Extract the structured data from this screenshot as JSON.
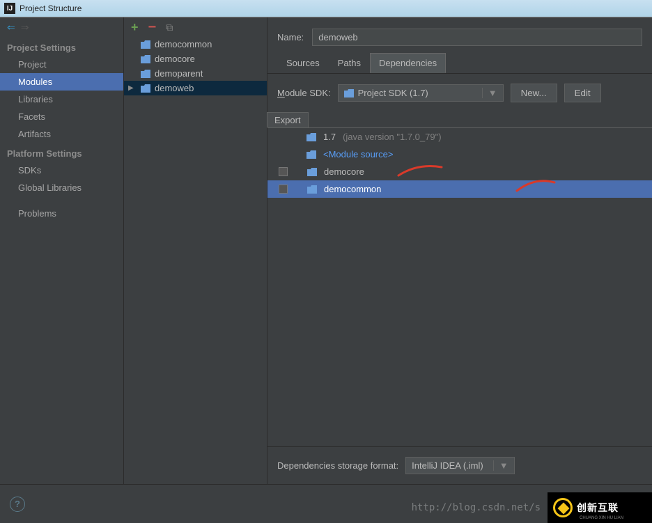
{
  "window": {
    "title": "Project Structure"
  },
  "sidebar": {
    "sections": [
      {
        "header": "Project Settings",
        "items": [
          "Project",
          "Modules",
          "Libraries",
          "Facets",
          "Artifacts"
        ],
        "selected": 1
      },
      {
        "header": "Platform Settings",
        "items": [
          "SDKs",
          "Global Libraries"
        ]
      }
    ],
    "problems": "Problems"
  },
  "modules": {
    "items": [
      "democommon",
      "democore",
      "demoparent",
      "demoweb"
    ],
    "selected": 3
  },
  "detail": {
    "name_label": "Name:",
    "name_value": "demoweb",
    "tabs": [
      "Sources",
      "Paths",
      "Dependencies"
    ],
    "active_tab": 2,
    "sdk_label_prefix": "M",
    "sdk_label_rest": "odule SDK:",
    "sdk_value": "Project SDK (1.7)",
    "btn_new": "New...",
    "btn_edit": "Edit",
    "export_header": "Export",
    "deps": [
      {
        "name": "1.7",
        "version": "(java version \"1.7.0_79\")",
        "checkbox": false,
        "type": "sdk"
      },
      {
        "name": "<Module source>",
        "checkbox": false,
        "type": "modsrc"
      },
      {
        "name": "democore",
        "checkbox": true,
        "type": "mod"
      },
      {
        "name": "democommon",
        "checkbox": true,
        "type": "mod",
        "selected": true
      }
    ],
    "storage_label": "Dependencies storage format:",
    "storage_value": "IntelliJ IDEA (.iml)"
  },
  "watermark": {
    "url": "http://blog.csdn.net/s",
    "brand": "创新互联",
    "brand_sub": "CHUANG XIN HU LIAN"
  }
}
